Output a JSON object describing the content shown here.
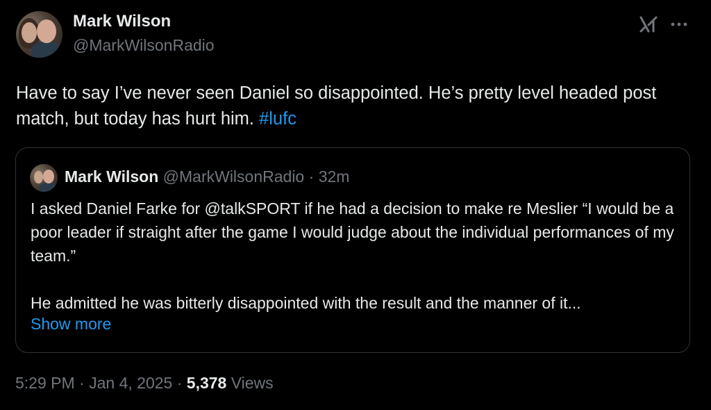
{
  "tweet": {
    "author": {
      "display_name": "Mark Wilson",
      "handle": "@MarkWilsonRadio"
    },
    "text": "Have to say I’ve never seen Daniel so disappointed. He’s pretty level headed post match, but today has hurt him. ",
    "hashtag": "#lufc",
    "icons": {
      "grok": "grok-icon",
      "more": "more-options-icon"
    },
    "quote": {
      "display_name": "Mark Wilson",
      "handle": "@MarkWilsonRadio",
      "separator": "·",
      "age": "32m",
      "paragraph1": "I asked Daniel Farke for @talkSPORT if he had a decision to make re Meslier “I would be a poor leader if straight after the game I would judge about the individual performances of my team.”",
      "paragraph2": "He admitted he was bitterly disappointed with the result and the manner of it...",
      "show_more": "Show more"
    },
    "footer": {
      "time": "5:29 PM",
      "dot1": "·",
      "date": "Jan 4, 2025",
      "dot2": "·",
      "views_count": "5,378",
      "views_label": "Views"
    },
    "colors": {
      "background": "#000000",
      "text": "#e7e9ea",
      "secondary": "#71767b",
      "link": "#1d9bf0",
      "border": "#2f3336"
    }
  }
}
